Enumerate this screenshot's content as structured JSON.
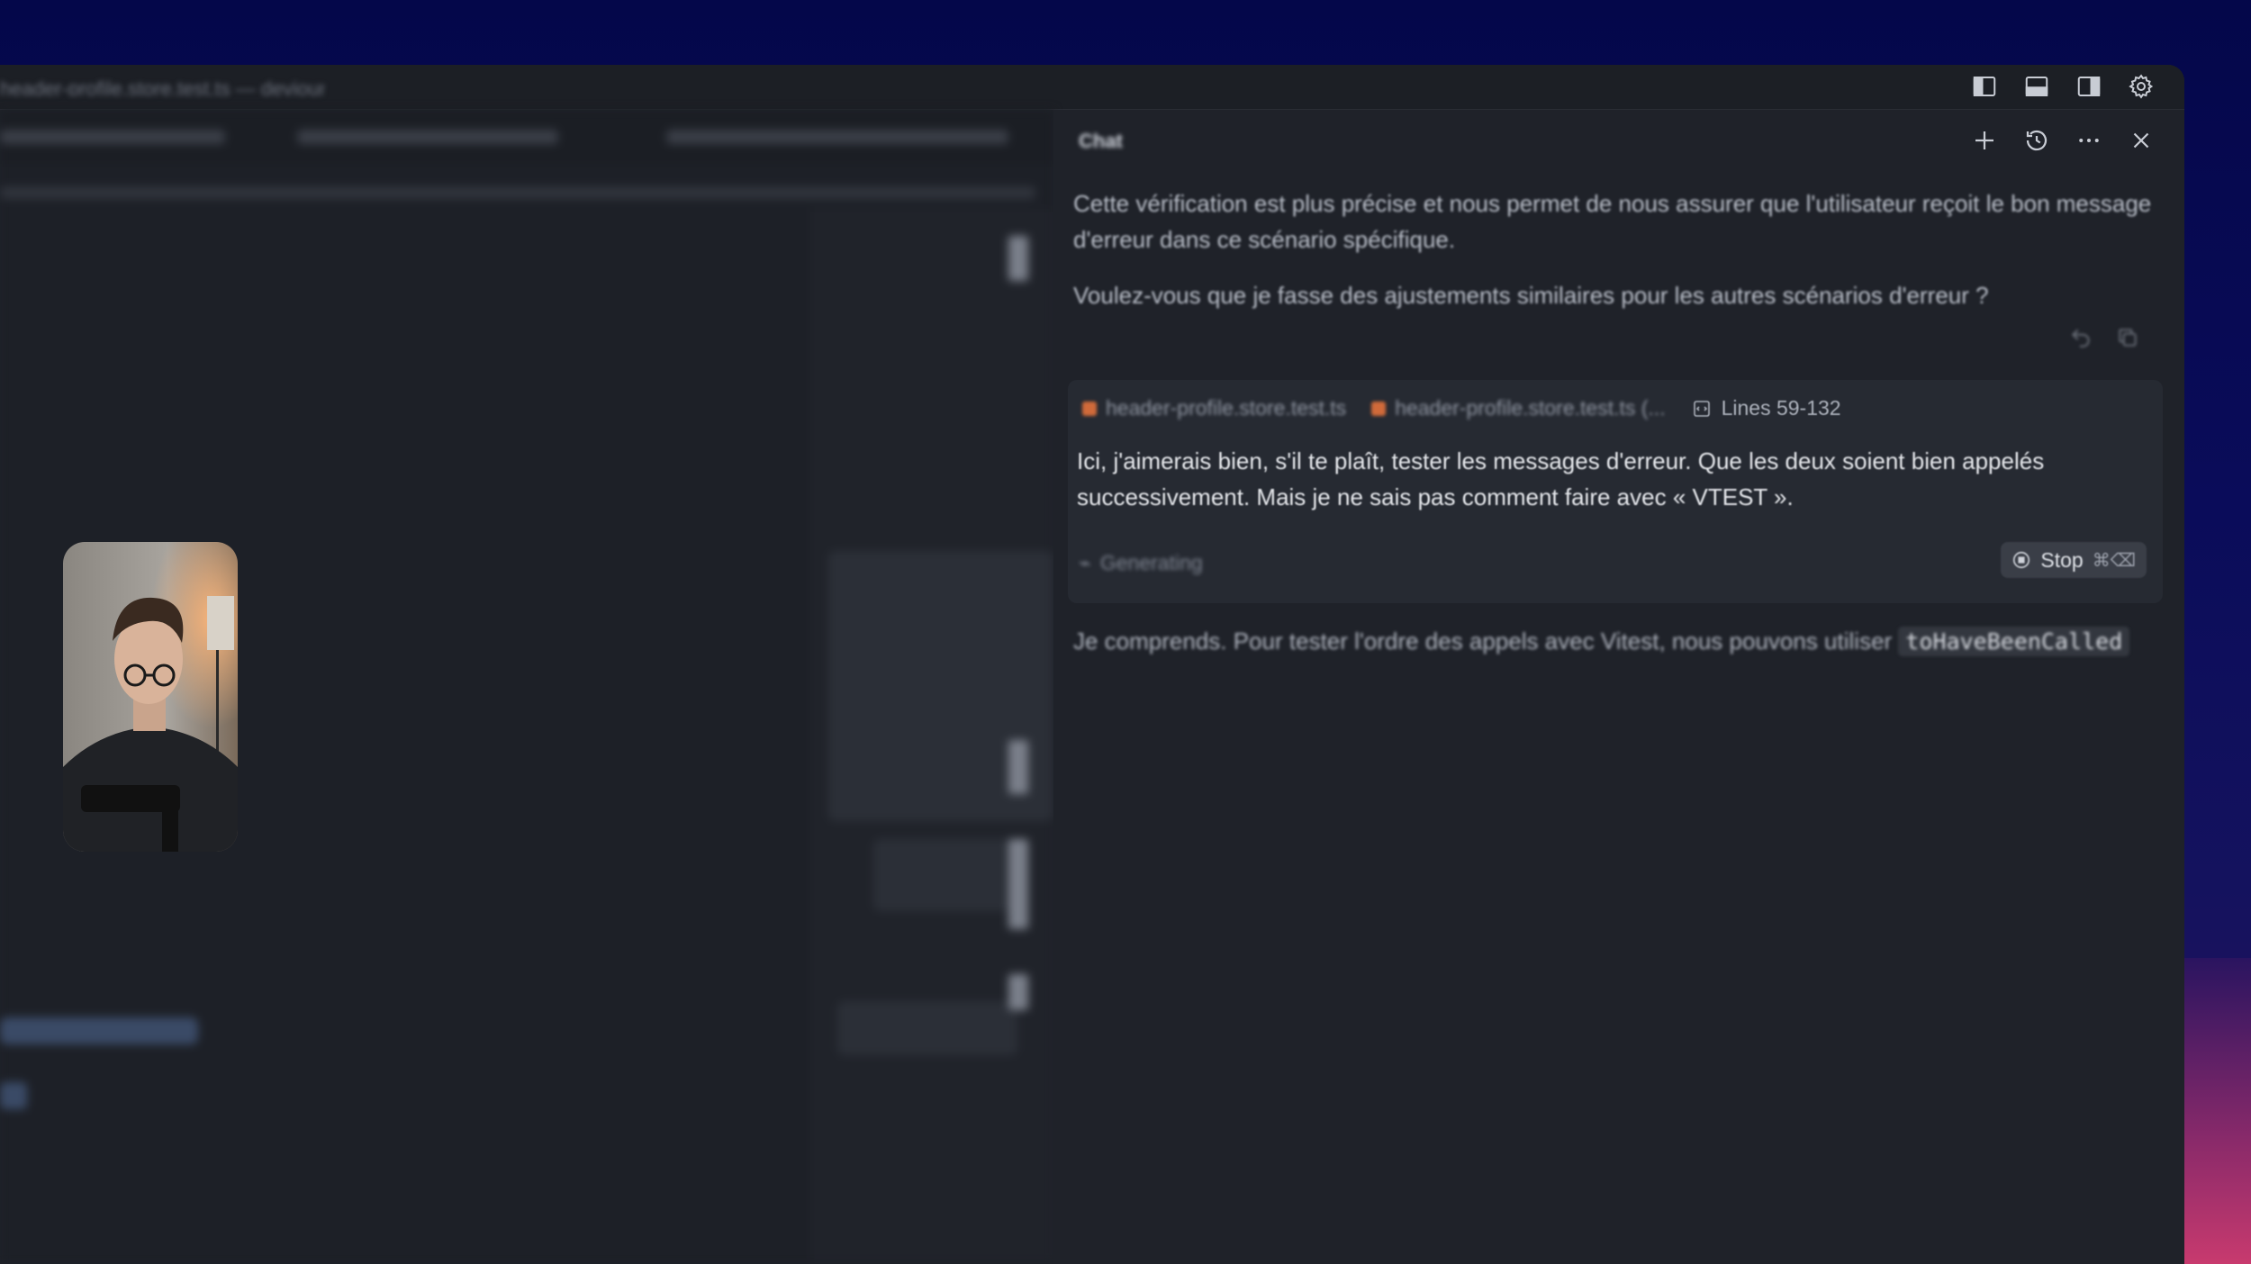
{
  "window": {
    "title": "header-profile.store.test.ts — devjournal"
  },
  "titlebar": {
    "icons": [
      "toggle-primary-sidebar-icon",
      "toggle-panel-icon",
      "toggle-secondary-sidebar-icon",
      "settings-gear-icon"
    ]
  },
  "editor": {
    "tab_label": "header-profile.store.test.ts",
    "breadcrumb": "header-profile.store.test.ts › describe › should handle error rejection gracefully callback"
  },
  "chat": {
    "title": "Chat",
    "header_icons": [
      "new-chat-icon",
      "history-icon",
      "more-icon",
      "close-icon"
    ],
    "assistant_message_1": "Cette vérification est plus précise et nous permet de nous assurer que l'utilisateur reçoit le bon message d'erreur dans ce scénario spécifique.",
    "assistant_message_2": "Voulez-vous que je fasse des ajustements similaires pour les autres scénarios d'erreur ?",
    "context": {
      "file_1": "header-profile.store.test.ts",
      "file_2": "header-profile.store.test.ts (...",
      "lines": "Lines 59-132"
    },
    "user_message": "Ici, j'aimerais bien, s'il te plaît, tester les messages d'erreur. Que les deux soient bien appelés successivement. Mais je ne sais pas comment faire avec « VTEST ».",
    "generating_label": "Generating",
    "stop_label": "Stop",
    "stop_shortcut": "⌘⌫",
    "reply_text": "Je comprends. Pour tester l'ordre des appels avec Vitest, nous pouvons utiliser",
    "reply_code": "toHaveBeenCalled"
  },
  "colors": {
    "background": "#04074a",
    "window": "#1f2229",
    "user_box": "#262a32",
    "file_dot": "#d06a3a"
  }
}
